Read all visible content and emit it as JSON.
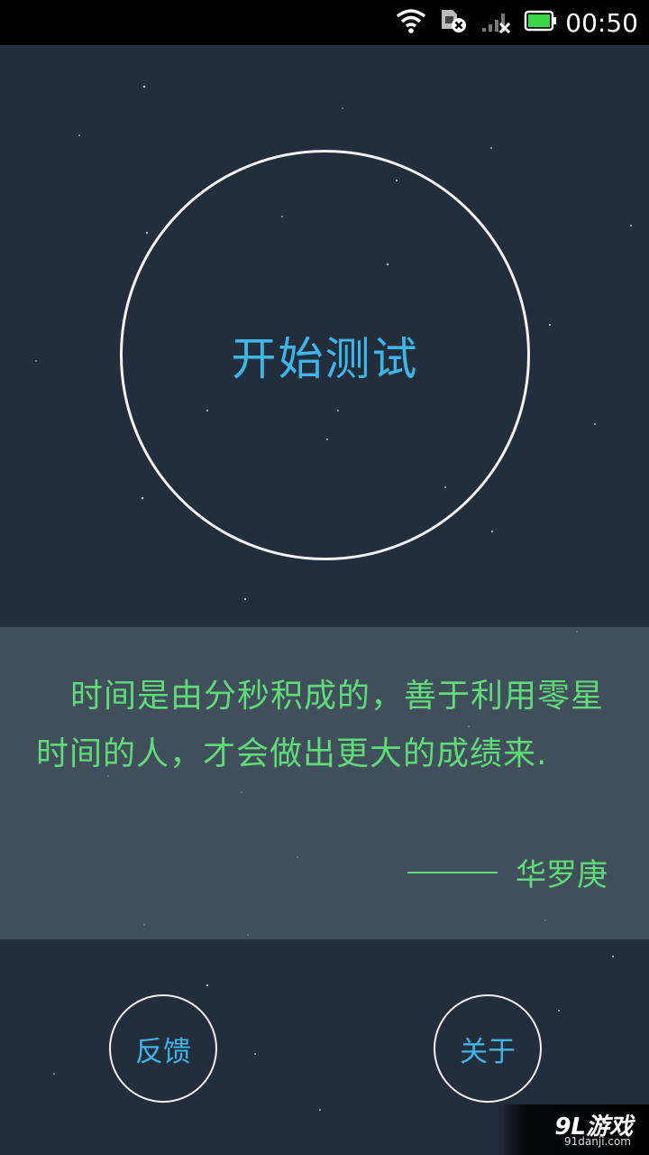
{
  "status_bar": {
    "time": "00:50",
    "battery_color": "#3cd64a"
  },
  "main": {
    "start_button_label": "开始测试"
  },
  "quote": {
    "text": "时间是由分秒积成的，善于利用零星时间的人，才会做出更大的成绩来.",
    "author": "华罗庚"
  },
  "buttons": {
    "feedback_label": "反馈",
    "about_label": "关于"
  },
  "watermark": {
    "logo": "9L游戏",
    "url": "91danji.com"
  },
  "colors": {
    "background": "#232e3d",
    "accent_blue": "#3fb6e8",
    "quote_green": "#5fdc77"
  }
}
